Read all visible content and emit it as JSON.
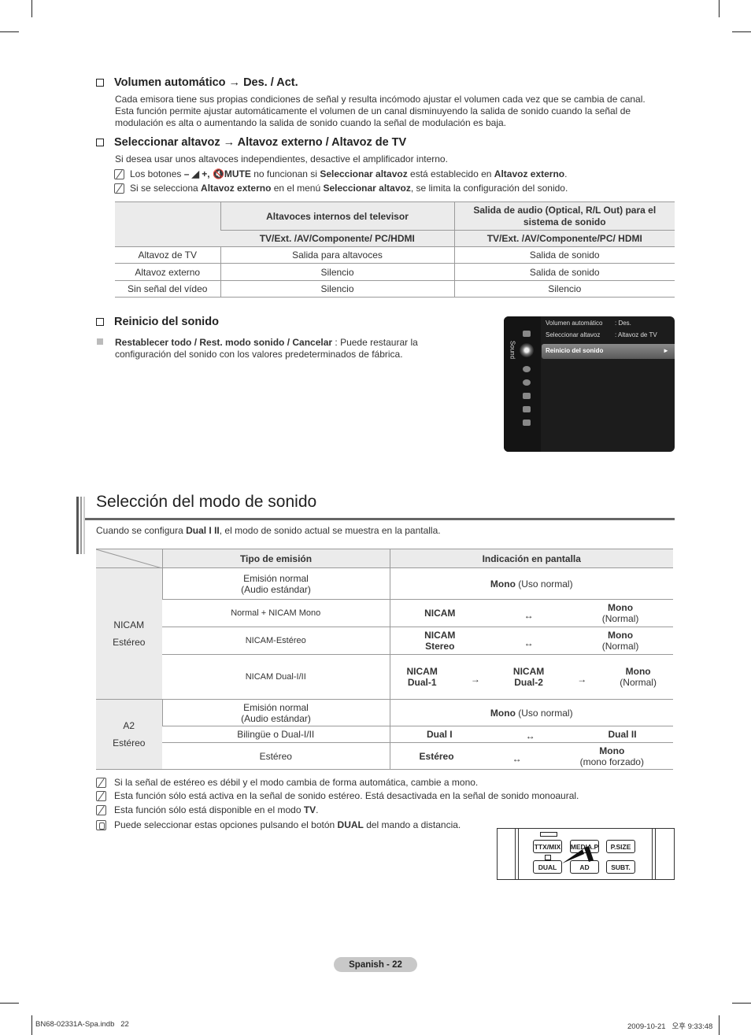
{
  "section_volume": {
    "heading": "Volumen automático → Des. / Act.",
    "body": [
      "Cada emisora tiene sus propias condiciones de señal y resulta incómodo ajustar el volumen cada vez que se cambia de canal.",
      "Esta función permite ajustar automáticamente el volumen de un canal disminuyendo la salida de sonido cuando la señal de",
      "modulación es alta o aumentando la salida de sonido cuando la señal de modulación es baja."
    ]
  },
  "section_speaker": {
    "heading": "Seleccionar altavoz → Altavoz externo / Altavoz de TV",
    "body": "Si desea usar unos altavoces independientes, desactive el amplificador interno.",
    "note1": {
      "pre": "Los botones ",
      "buttons": "– ◢ +, 🔇MUTE",
      "mid": " no funcionan si ",
      "b1": "Seleccionar altavoz",
      "mid2": " está establecido en ",
      "b2": "Altavoz externo",
      "end": "."
    },
    "note2": {
      "pre": "Si se selecciona ",
      "b1": "Altavoz externo",
      "mid": " en el menú ",
      "b2": "Seleccionar altavoz",
      "end": ", se limita la configuración del sonido."
    },
    "table": {
      "header_top": [
        "",
        "Altavoces internos del televisor",
        "Salida de audio (Optical, R/L Out) para el sistema de sonido"
      ],
      "header_sub": [
        "TV/Ext. /AV/Componente/ PC/HDMI",
        "TV/Ext. /AV/Componente/PC/ HDMI"
      ],
      "rows": [
        [
          "Altavoz de TV",
          "Salida para altavoces",
          "Salida de sonido"
        ],
        [
          "Altavoz externo",
          "Silencio",
          "Salida de sonido"
        ],
        [
          "Sin señal del vídeo",
          "Silencio",
          "Silencio"
        ]
      ]
    }
  },
  "section_reset": {
    "heading": "Reinicio del sonido",
    "bold": "Restablecer todo / Rest. modo sonido / Cancelar",
    "rest": " : Puede restaurar la",
    "line2": "configuración del sonido con los valores predeterminados de fábrica."
  },
  "tv_menu": {
    "side_label": "Sound",
    "items": [
      {
        "label": "Volumen automático",
        "value": ": Des."
      },
      {
        "label": "Seleccionar altavoz",
        "value": ": Altavoz de TV"
      },
      {
        "label": "Reinicio del sonido",
        "value": "►"
      }
    ]
  },
  "section_mode": {
    "title": "Selección del modo de sonido",
    "intro_pre": "Cuando se configura ",
    "intro_bold": "Dual I II",
    "intro_post": ", el modo de sonido actual se muestra en la pantalla.",
    "table": {
      "headers": [
        "Tipo de emisión",
        "Indicación en pantalla"
      ],
      "groups": [
        {
          "name": [
            "NICAM",
            "Estéreo"
          ],
          "rows": [
            {
              "type": [
                "Emisión normal",
                "(Audio estándar)"
              ],
              "display": {
                "single_bold": "Mono",
                "single_rest": " (Uso normal)"
              }
            },
            {
              "type": [
                "Normal + NICAM Mono"
              ],
              "display": {
                "left": [
                  "NICAM"
                ],
                "arrow": "↔",
                "right_bold": "Mono",
                "right_rest": "(Normal)"
              }
            },
            {
              "type": [
                "NICAM-Estéreo"
              ],
              "display": {
                "left": [
                  "NICAM",
                  "Stereo"
                ],
                "arrow": "↔",
                "right_bold": "Mono",
                "right_rest": "(Normal)"
              }
            },
            {
              "type": [
                "NICAM Dual-I/II"
              ],
              "display": {
                "left": [
                  "NICAM",
                  "Dual-1"
                ],
                "arrow": "→",
                "mid": [
                  "NICAM",
                  "Dual-2"
                ],
                "arrow2": "→",
                "right_bold": "Mono",
                "right_rest": "(Normal)"
              }
            }
          ]
        },
        {
          "name": [
            "A2",
            "Estéreo"
          ],
          "rows": [
            {
              "type": [
                "Emisión normal",
                "(Audio estándar)"
              ],
              "display": {
                "single_bold": "Mono",
                "single_rest": " (Uso normal)"
              }
            },
            {
              "type": [
                "Bilingüe o Dual-I/II"
              ],
              "display": {
                "left": [
                  "Dual I"
                ],
                "arrow": "↔",
                "right_bold": "Dual II",
                "right_rest": ""
              }
            },
            {
              "type": [
                "Estéreo"
              ],
              "display": {
                "left": [
                  "Estéreo"
                ],
                "arrow": "↔",
                "right_bold": "Mono",
                "right_rest": "(mono forzado)"
              }
            }
          ]
        }
      ]
    },
    "notes": [
      {
        "text": "Si la señal de estéreo es débil y el modo cambia de forma automática, cambie a mono."
      },
      {
        "text": "Esta función sólo está activa en la señal de sonido estéreo. Está desactivada en la señal de sonido monoaural."
      },
      {
        "pre": "Esta función sólo está disponible en el modo ",
        "bold": "TV",
        "post": "."
      },
      {
        "pre": "Puede seleccionar estas opciones pulsando el botón ",
        "bold": "DUAL",
        "post": " del mando a distancia."
      }
    ]
  },
  "remote": {
    "buttons": [
      "TTX/MIX",
      "MEDIA.P",
      "P.SIZE",
      "DUAL",
      "AD",
      "SUBT."
    ]
  },
  "footer": {
    "page_label": "Spanish - 22",
    "file": "BN68-02331A-Spa.indb   22",
    "timestamp": "2009-10-21   오후 9:33:48"
  }
}
